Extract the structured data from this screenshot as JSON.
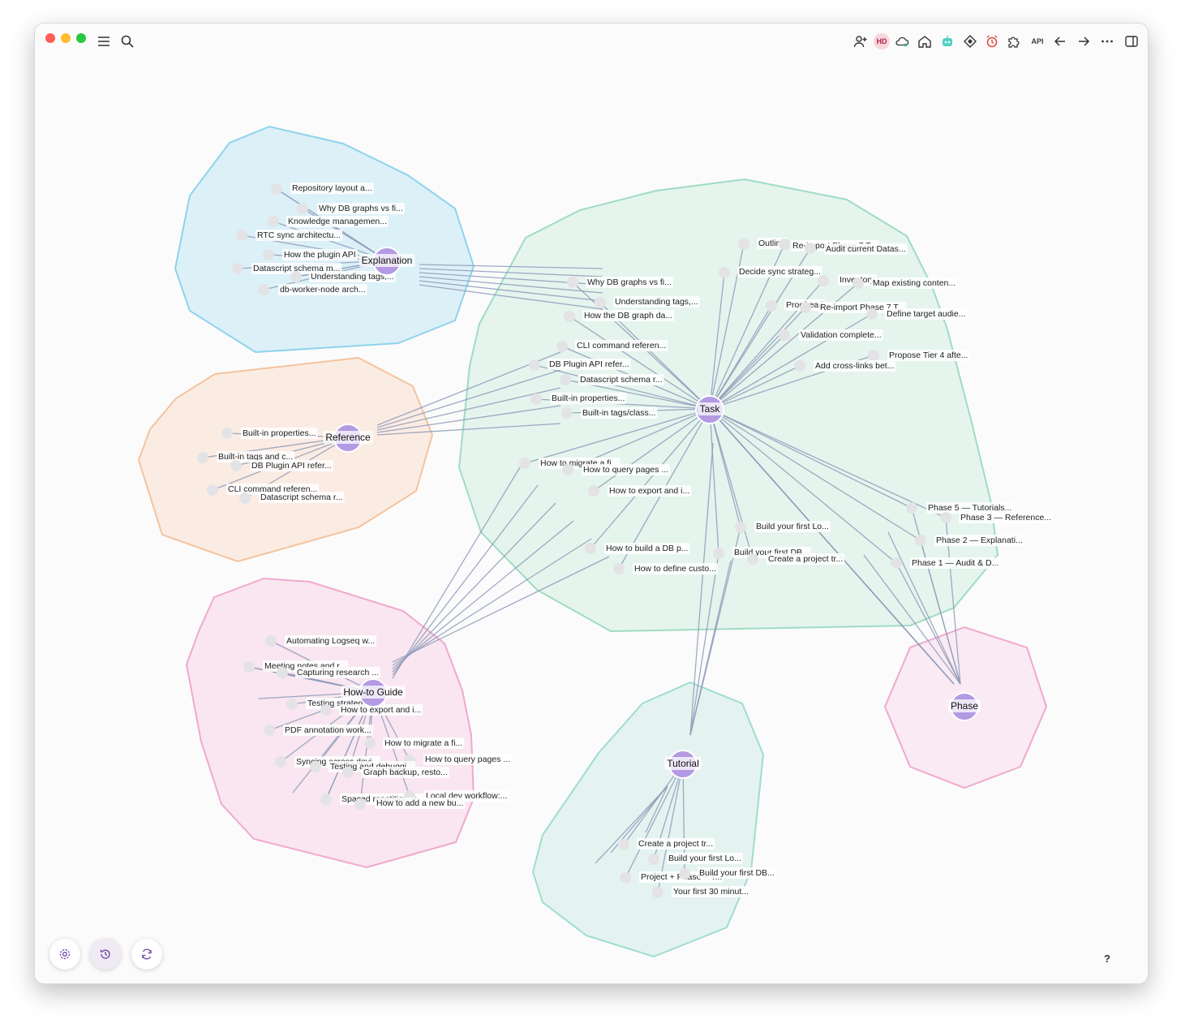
{
  "toolbar": {
    "menu_icon": "menu-icon",
    "search_icon": "search-icon",
    "avatar_initials": "HD",
    "api_label": "API"
  },
  "graph": {
    "groups": [
      {
        "name": "Explanation",
        "color": "#bde6f5",
        "stroke": "#8fd3ec"
      },
      {
        "name": "Task",
        "color": "#d3efe2",
        "stroke": "#9fdcc4"
      },
      {
        "name": "Reference",
        "color": "#fbe3d3",
        "stroke": "#f4c39e"
      },
      {
        "name": "How-to Guide",
        "color": "#f9d9ea",
        "stroke": "#f0a9cd"
      },
      {
        "name": "Tutorial",
        "color": "#d5efea",
        "stroke": "#9fdcd2"
      },
      {
        "name": "Phase",
        "color": "#f9e0ee",
        "stroke": "#f0a9cd"
      }
    ],
    "hubs": {
      "explanation": "Explanation",
      "task": "Task",
      "reference": "Reference",
      "howto": "How-to Guide",
      "tutorial": "Tutorial",
      "phase": "Phase"
    },
    "explanation_nodes": [
      "Repository layout a...",
      "Why DB graphs vs fi...",
      "Knowledge managemen...",
      "RTC sync architectu...",
      "How the plugin API",
      "Datascript schema m...",
      "Understanding tags,...",
      "db-worker-node arch..."
    ],
    "task_nodes": [
      "Outline",
      "Re-import Phase 7 T...",
      "Audit current Datas...",
      "Decide sync strateg...",
      "Inventory",
      "Map existing conten...",
      "Proofread",
      "Re-import Phase 7 T...",
      "Define target audie...",
      "Validation complete...",
      "Propose Tier 4 afte...",
      "Add cross-links bet...",
      "Why DB graphs vs fi...",
      "Understanding tags,...",
      "How the DB graph da...",
      "CLI command referen...",
      "DB Plugin API refer...",
      "Datascript schema r...",
      "Built-in properties...",
      "Built-in tags/class...",
      "How to migrate a fi...",
      "How to query pages ...",
      "How to export and i...",
      "How to build a DB p...",
      "How to define custo...",
      "Build your first Lo...",
      "Build your first DB...",
      "Create a project tr...",
      "Phase 5 — Tutorials...",
      "Phase 3 — Reference...",
      "Phase 2 — Explanati...",
      "Phase 1 — Audit & D..."
    ],
    "reference_nodes": [
      "Built-in properties...",
      "Built-in tags and c...",
      "DB Plugin API refer...",
      "CLI command referen...",
      "Datascript schema r..."
    ],
    "howto_nodes": [
      "Automating Logseq w...",
      "Meeting notes and r...",
      "Capturing research ...",
      "Testing strategy: u...",
      "How to export and i...",
      "PDF annotation work...",
      "How to migrate a fi...",
      "How to query pages ...",
      "Syncing across devi...",
      "Testing and debuggi...",
      "Graph backup, resto...",
      "Spaced repetition w...",
      "Local dev workflow:...",
      "How to add a new bu..."
    ],
    "tutorial_nodes": [
      "Create a project tr...",
      "Build your first Lo...",
      "Project + Phase + T...",
      "Build your first DB...",
      "Your first 30 minut..."
    ]
  },
  "bottom_controls": {
    "settings_icon": "settings-icon",
    "history_icon": "history-icon",
    "refresh_icon": "refresh-icon",
    "help_label": "?"
  }
}
